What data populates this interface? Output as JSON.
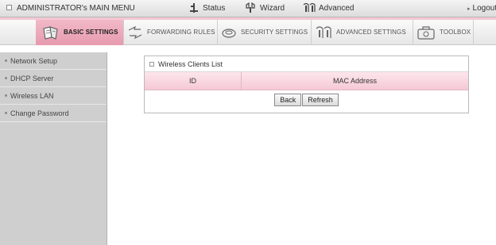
{
  "topmenu": {
    "admin": "ADMINISTRATOR's MAIN MENU",
    "status": "Status",
    "wizard": "Wizard",
    "advanced": "Advanced",
    "logout": "Logout"
  },
  "tabs": [
    {
      "label": "BASIC SETTINGS",
      "icon": "book-icon",
      "active": true
    },
    {
      "label": "FORWARDING RULES",
      "icon": "arrows-icon",
      "active": false
    },
    {
      "label": "SECURITY SETTINGS",
      "icon": "lock-icon",
      "active": false
    },
    {
      "label": "ADVANCED SETTINGS",
      "icon": "gear-icon",
      "active": false
    },
    {
      "label": "TOOLBOX",
      "icon": "toolbox-icon",
      "active": false
    }
  ],
  "sidebar": {
    "items": [
      {
        "label": "Network Setup"
      },
      {
        "label": "DHCP Server"
      },
      {
        "label": "Wireless LAN"
      },
      {
        "label": "Change Password"
      }
    ]
  },
  "panel": {
    "title": "Wireless Clients List",
    "columns": [
      "ID",
      "MAC Address"
    ],
    "buttons": {
      "back": "Back",
      "refresh": "Refresh"
    }
  },
  "colors": {
    "accent_pink": "#f1b9c8",
    "header_pink": "#f5c9d5",
    "sidebar_gray": "#cfcfcf"
  }
}
